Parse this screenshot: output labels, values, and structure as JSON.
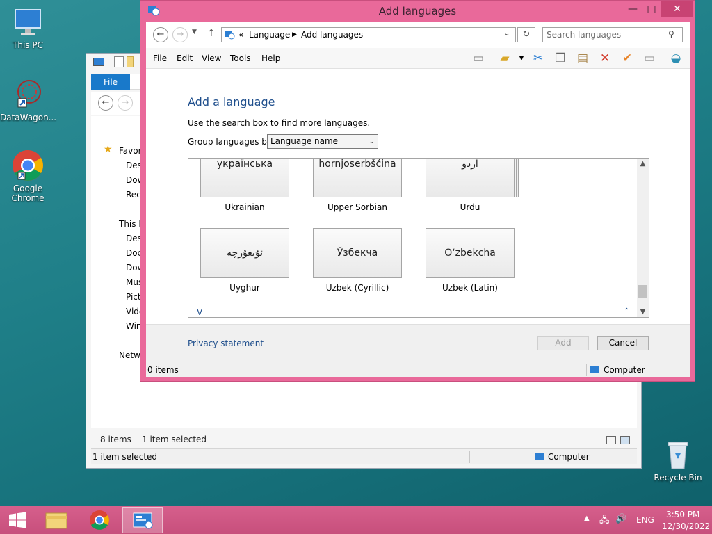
{
  "desktop": {
    "icons": [
      {
        "label": "This PC"
      },
      {
        "label": "DataWagon..."
      },
      {
        "label": "Google Chrome"
      },
      {
        "label": "Recycle Bin"
      }
    ]
  },
  "background_window": {
    "ribbon_file": "File",
    "nav": {
      "favorites": "Favor",
      "fav_items": [
        "Des",
        "Dow",
        "Rec"
      ],
      "this_pc": "This P",
      "pc_items": [
        "Des",
        "Doc",
        "Dow",
        "Mus",
        "Pict",
        "Vide",
        "Win"
      ],
      "network": "Netw"
    },
    "status_items": "8 items",
    "status_selected": "1 item selected",
    "bottom_selected": "1 item selected",
    "bottom_computer": "Computer"
  },
  "dialog": {
    "title": "Add languages",
    "address": {
      "prefix": "«",
      "crumb1": "Language",
      "crumb2": "Add languages"
    },
    "search_placeholder": "Search languages",
    "menu": [
      "File",
      "Edit",
      "View",
      "Tools",
      "Help"
    ],
    "heading": "Add a language",
    "instruction": "Use the search box to find more languages.",
    "group_label": "Group languages by:",
    "group_value": "Language name",
    "languages_row1": [
      {
        "native": "українська",
        "name": "Ukrainian"
      },
      {
        "native": "hornjoserbšćina",
        "name": "Upper Sorbian"
      },
      {
        "native": "أردو",
        "name": "Urdu"
      }
    ],
    "languages_row2": [
      {
        "native": "ئۇيغۇرچە",
        "name": "Uyghur"
      },
      {
        "native": "Ўзбекча",
        "name": "Uzbek (Cyrillic)"
      },
      {
        "native": "O‘zbekcha",
        "name": "Uzbek (Latin)"
      }
    ],
    "group_letter": "V",
    "privacy": "Privacy statement",
    "add_label": "Add",
    "cancel_label": "Cancel",
    "status_items": "0 items",
    "status_computer": "Computer"
  },
  "taskbar": {
    "language": "ENG",
    "time": "3:50 PM",
    "date": "12/30/2022"
  },
  "colors": {
    "accent_pink": "#e9699a",
    "close_red": "#c84373",
    "link_blue": "#1e4e8c",
    "file_blue": "#1979ca"
  }
}
